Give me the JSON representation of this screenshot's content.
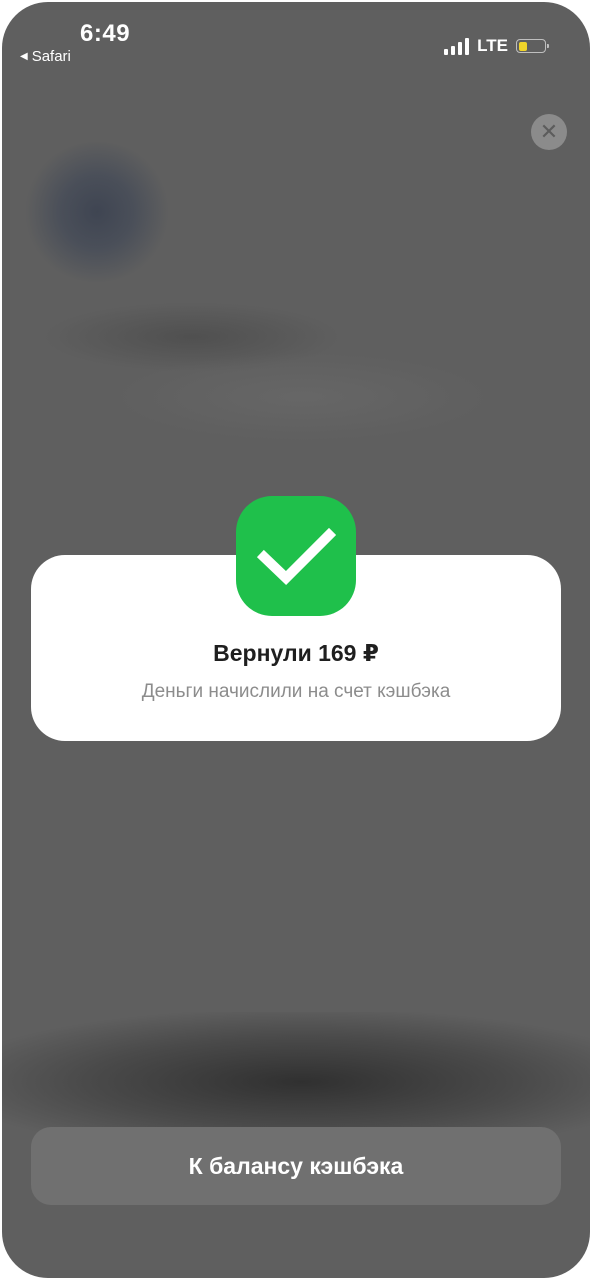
{
  "status_bar": {
    "time": "6:49",
    "back_label": "Safari",
    "back_icon": "triangle-left-icon",
    "network": "LTE",
    "signal_bars": 4,
    "battery_level": 0.35,
    "battery_color": "#f1d52a"
  },
  "close_button": {
    "icon": "close-icon",
    "glyph": "✕"
  },
  "card": {
    "icon": "checkmark-icon",
    "icon_color": "#1fc04b",
    "title": "Вернули 169 ₽",
    "subtitle": "Деньги начислили на счет кэшбэка"
  },
  "primary_button": {
    "label": "К балансу кэшбэка"
  }
}
